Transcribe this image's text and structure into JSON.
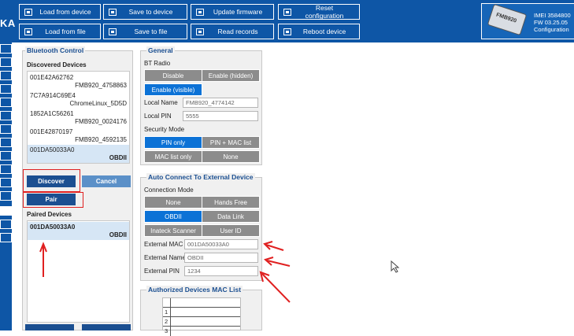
{
  "brand": {
    "logo_text": "KA"
  },
  "toolbar": {
    "load_from_device": "Load from device",
    "save_to_device": "Save to device",
    "update_firmware": "Update firmware",
    "reset_configuration": "Reset configuration",
    "load_from_file": "Load from file",
    "save_to_file": "Save to file",
    "read_records": "Read records",
    "reboot_device": "Reboot device"
  },
  "device": {
    "model_label": "FMB920",
    "imei": "IMEI 3584800",
    "fw": "FW 03.25.05",
    "configuration": "Configuration"
  },
  "bluetooth": {
    "title": "Bluetooth Control",
    "discovered_title": "Discovered Devices",
    "discovered": [
      {
        "mac": "001E42A62762",
        "name": "FMB920_4758863"
      },
      {
        "mac": "7C7A914C69E4",
        "name": "ChromeLinux_5D5D"
      },
      {
        "mac": "1852A1C56261",
        "name": "FMB920_0024176"
      },
      {
        "mac": "001E42870197",
        "name": "FMB920_4592135"
      },
      {
        "mac": "001DA50033A0",
        "name": "OBDII"
      }
    ],
    "discover_label": "Discover",
    "cancel_label": "Cancel",
    "pair_label": "Pair",
    "paired_title": "Paired Devices",
    "paired": [
      {
        "mac": "001DA50033A0",
        "name": "OBDII"
      }
    ]
  },
  "general": {
    "title": "General",
    "bt_radio_label": "BT Radio",
    "bt_radio_options": [
      "Disable",
      "Enable (hidden)",
      "Enable (visible)"
    ],
    "local_name_label": "Local Name",
    "local_name_value": "FMB920_4774142",
    "local_pin_label": "Local PIN",
    "local_pin_value": "5555",
    "security_mode_label": "Security Mode",
    "security_options": [
      "PIN only",
      "PIN + MAC list",
      "MAC list only",
      "None"
    ]
  },
  "auto_connect": {
    "title": "Auto Connect To External Device",
    "connection_mode_label": "Connection Mode",
    "options": [
      "None",
      "Hands Free",
      "OBDII",
      "Data Link",
      "Inateck Scanner",
      "User ID"
    ],
    "external_mac_label": "External MAC",
    "external_mac_value": "001DA50033A0",
    "external_name_label": "External Name",
    "external_name_value": "OBDII",
    "external_pin_label": "External PIN",
    "external_pin_value": "1234"
  },
  "authorized": {
    "title": "Authorized Devices MAC List",
    "rows": [
      "1",
      "2",
      "3"
    ]
  },
  "colors": {
    "brand_blue": "#0e56a6",
    "accent": "#0c72d6",
    "annotation": "#e02020"
  }
}
